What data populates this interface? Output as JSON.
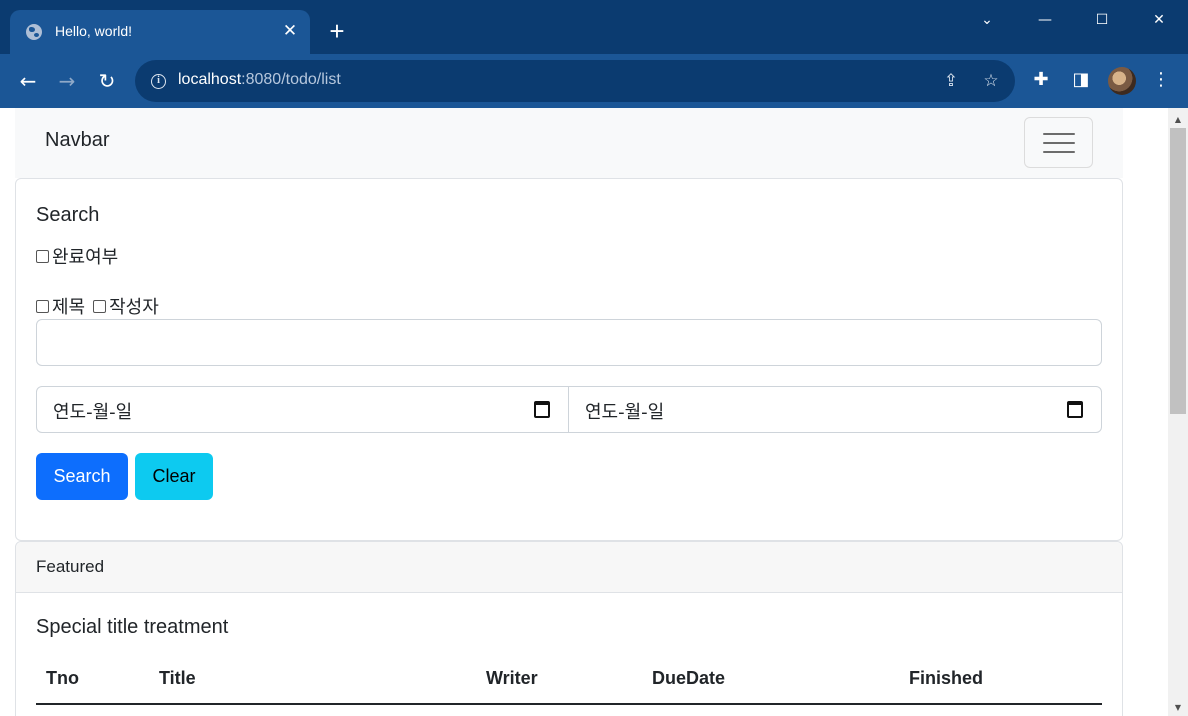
{
  "browser": {
    "tab_title": "Hello, world!",
    "tab_close": "✕",
    "new_tab": "+",
    "url_host": "localhost",
    "url_path": ":8080/todo/list",
    "window_controls": [
      "⌄",
      "—",
      "☐",
      "✕"
    ]
  },
  "navbar": {
    "brand": "Navbar"
  },
  "search": {
    "title": "Search",
    "finished_label": "완료여부",
    "type_title_label": "제목",
    "type_writer_label": "작성자",
    "keyword_value": "",
    "from_date": "연도-월-일",
    "to_date": "연도-월-일",
    "search_button": "Search",
    "clear_button": "Clear"
  },
  "featured": {
    "header": "Featured",
    "title": "Special title treatment",
    "columns": [
      "Tno",
      "Title",
      "Writer",
      "DueDate",
      "Finished"
    ]
  },
  "colors": {
    "primary": "#0d6efd",
    "info": "#0dcaf0",
    "chrome_dark": "#0b3b70",
    "chrome": "#1b5696"
  }
}
